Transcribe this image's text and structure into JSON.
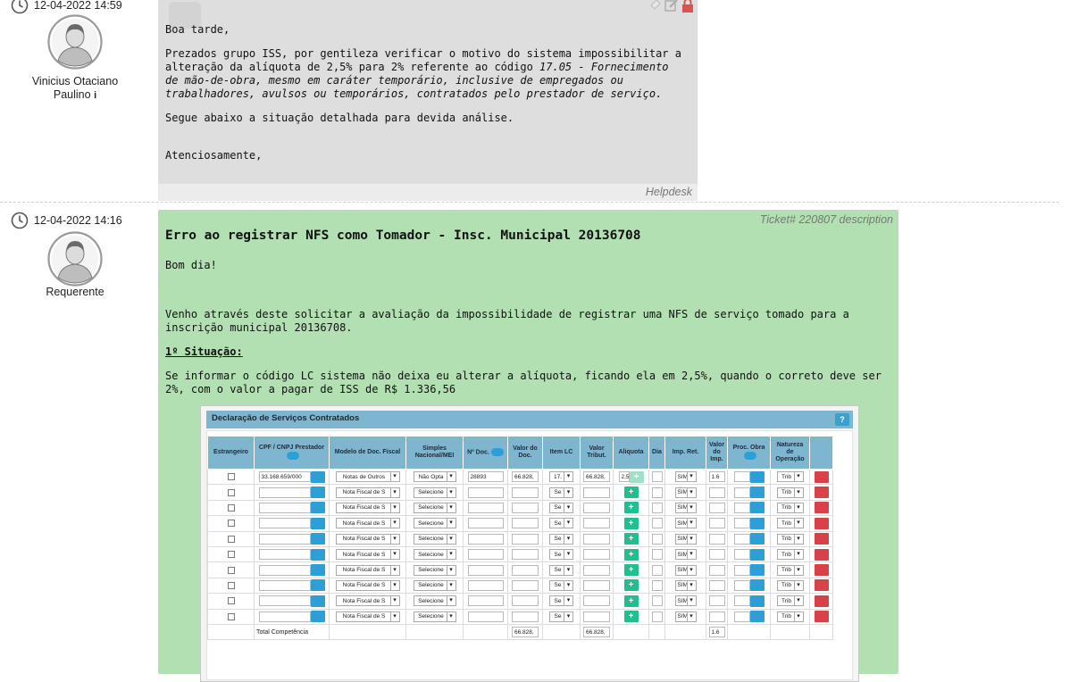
{
  "message1": {
    "timestamp": "12-04-2022 14:59",
    "author_line1": "Vinicius Otaciano",
    "author_line2": "Paulino",
    "info_glyph": "i",
    "greeting": "Boa tarde,",
    "paragraph1_normal": "Prezados grupo ISS, por gentileza verificar o motivo do sistema impossibilitar a alteração da alíquota de 2,5% para 2% referente ao código ",
    "paragraph1_italic": "17.05 - Fornecimento de mão-de-obra, mesmo em caráter temporário, inclusive de empregados ou trabalhadores, avulsos ou temporários, contratados pelo prestador de serviço.",
    "paragraph2": "Segue abaixo a situação detalhada para devida análise.",
    "closing": "Atenciosamente,",
    "footer_label": "Helpdesk",
    "icons": [
      "reply-icon",
      "edit-icon",
      "lock-icon"
    ]
  },
  "message2": {
    "timestamp": "12-04-2022 14:16",
    "author": "Requerente",
    "ticket_label": "Ticket# 220807 description",
    "title": "Erro ao registrar NFS como Tomador - Insc. Municipal 20136708",
    "greeting": "Bom dia!",
    "paragraph1": "Venho através deste solicitar a avaliação da impossibilidade de registrar uma NFS de serviço tomado para a inscrição municipal 20136708.",
    "situation_heading": "1º Situação:",
    "paragraph2": "Se informar o código LC sistema não deixa eu alterar a alíquota, ficando ela em 2,5%, quando o correto deve ser 2%, com o valor a pagar de ISS de R$ 1.336,56"
  },
  "embedded_form": {
    "title": "Declaração de Serviços Contratados",
    "help_label": "?",
    "columns": [
      "Estrangeiro",
      "CPF / CNPJ Prestador",
      "Modelo de Doc. Fiscal",
      "Simples Nacional/MEI",
      "Nº Doc.",
      "Valor do Doc.",
      "Item LC",
      "Valor Tribut.",
      "Aliquota",
      "Dia",
      "Imp. Ret.",
      "Valor do Imp.",
      "Proc. Obra",
      "Natureza de Operação",
      ""
    ],
    "first_row": {
      "cpf": "33.168.659/000",
      "modelo": "Notas de Outros",
      "simples": "Não Opta",
      "num_doc": "28893",
      "valor_doc": "66.828,",
      "item_lc": "17.",
      "valor_trib": "66.828,",
      "aliquota": "2,5",
      "imp_ret": "SIM",
      "valor_imp": "1.6",
      "natureza": "Trib"
    },
    "blank_row": {
      "modelo": "Nota Fiscal de S",
      "simples": "Selecione",
      "item_lc": "Se",
      "imp_ret": "SIM",
      "natureza": "Trib"
    },
    "blank_row_count": 9,
    "total_label": "Total Competência",
    "total_valor_doc": "66.828,",
    "total_valor_trib": "66.828,",
    "total_valor_imp": "1.6"
  }
}
